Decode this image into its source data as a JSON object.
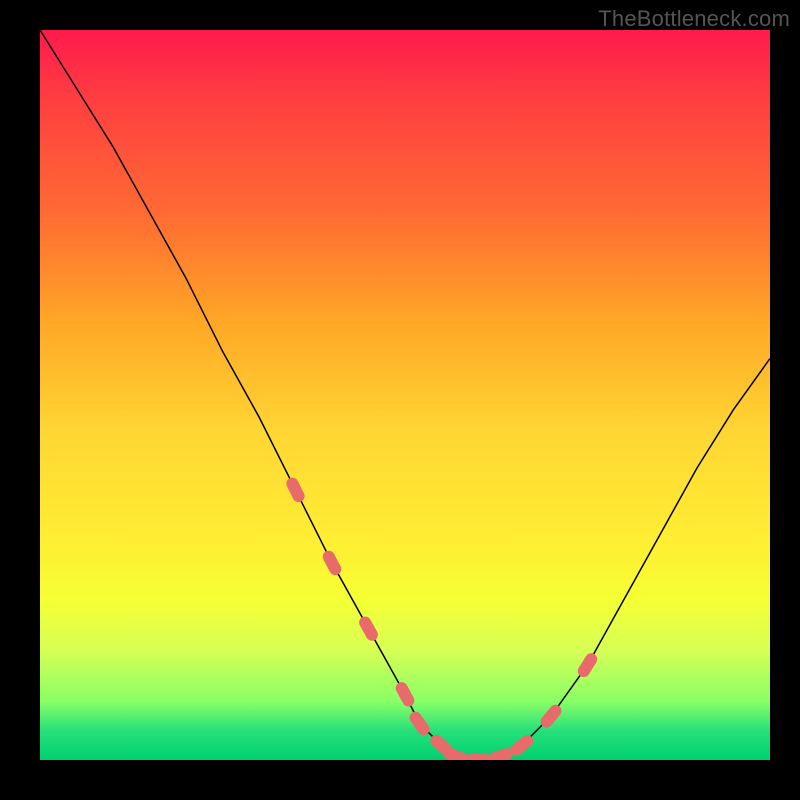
{
  "watermark": "TheBottleneck.com",
  "chart_data": {
    "type": "line",
    "title": "",
    "xlabel": "",
    "ylabel": "",
    "xlim": [
      0,
      100
    ],
    "ylim": [
      0,
      100
    ],
    "gradient_colors_top_to_bottom": [
      "#ff1a4d",
      "#ffa726",
      "#ffee33",
      "#00d070"
    ],
    "series": [
      {
        "name": "curve",
        "x": [
          0,
          5,
          10,
          15,
          20,
          25,
          30,
          35,
          40,
          45,
          50,
          52,
          55,
          57,
          60,
          63,
          66,
          70,
          75,
          80,
          85,
          90,
          95,
          100
        ],
        "y": [
          100,
          92,
          84,
          75,
          66,
          56,
          47,
          37,
          27,
          18,
          9,
          5,
          2,
          0.5,
          0,
          0.5,
          2,
          6,
          13,
          22,
          31,
          40,
          48,
          55
        ]
      }
    ],
    "markers": {
      "name": "highlighted-region",
      "color": "#e86a6a",
      "points_index_on_curve": [
        7,
        8,
        9,
        10,
        11,
        12,
        13,
        14,
        15,
        16,
        17,
        18
      ]
    }
  }
}
